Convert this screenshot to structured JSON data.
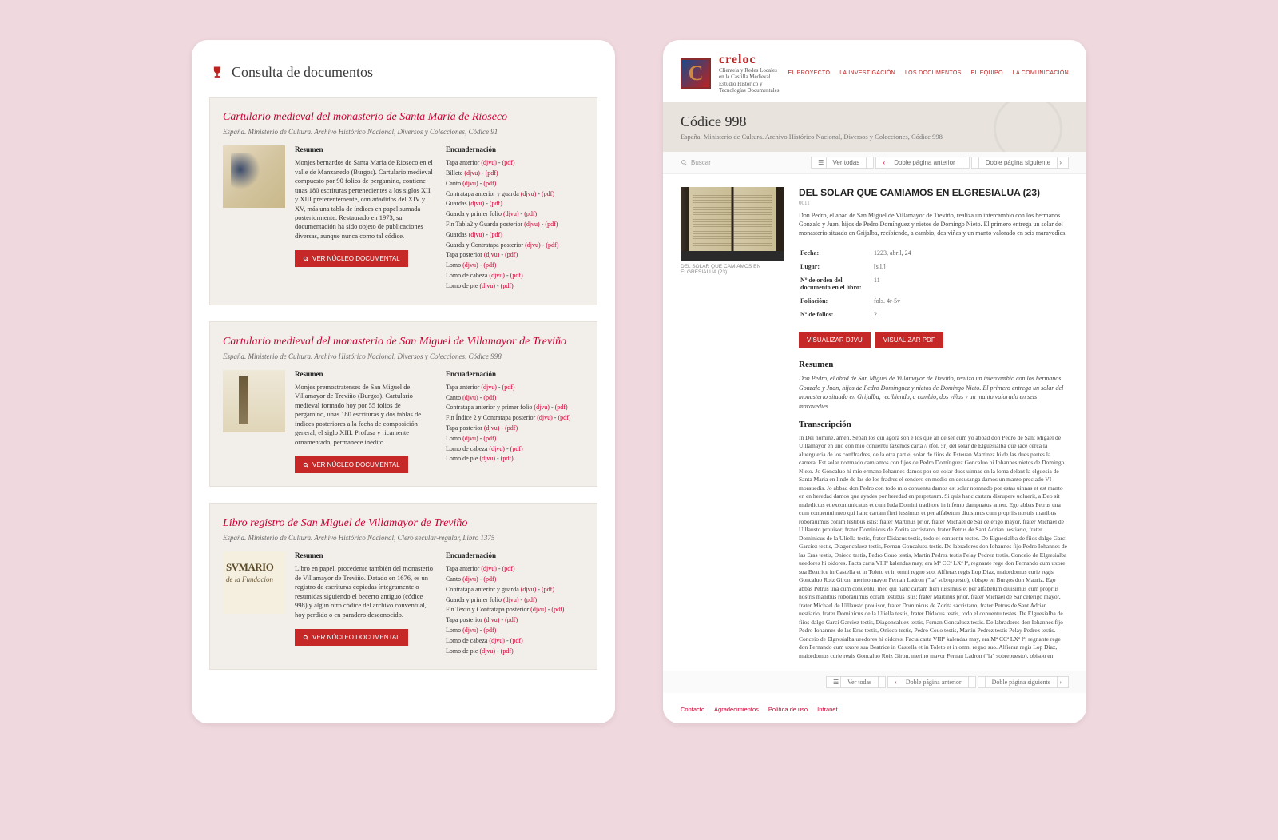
{
  "left": {
    "page_title": "Consulta de documentos",
    "cards": [
      {
        "title": "Cartulario medieval del monasterio de Santa María de Rioseco",
        "sub": "España. Ministerio de Cultura. Archivo Histórico Nacional, Diversos y Colecciones, Códice 91",
        "resumen_h": "Resumen",
        "resumen": "Monjes bernardos de Santa María de Rioseco en el valle de Manzanedo (Burgos). Cartulario medieval compuesto por 90 folios de pergamino, contiene unas 180 escrituras pertenecientes a los siglos XII y XIII preferentemente, con añadidos del XIV y XV, más una tabla de índices en papel sumada posteriormente. Restaurado en 1973, su documentación ha sido objeto de publicaciones diversas, aunque nunca como tal códice.",
        "btn": "VER NÚCLEO DOCUMENTAL",
        "enc_h": "Encuadernación",
        "enc": [
          "Tapa anterior (djvu) - (pdf)",
          "Billete (djvu) - (pdf)",
          "Canto (djvu) - (pdf)",
          "Contratapa anterior y guarda (djvu) - (pdf)",
          "Guardas (djvu) - (pdf)",
          "Guarda y primer folio (djvu) - (pdf)",
          "Fin Tabla2 y Guarda posterior (djvu) - (pdf)",
          "Guardas (djvu) - (pdf)",
          "Guarda y Contratapa posterior (djvu) - (pdf)",
          "Tapa posterior (djvu) - (pdf)",
          "Lomo (djvu) - (pdf)",
          "Lomo de cabeza (djvu) - (pdf)",
          "Lomo de pie (djvu) - (pdf)"
        ]
      },
      {
        "title": "Cartulario medieval del monasterio de San Miguel de Villamayor de Treviño",
        "sub": "España. Ministerio de Cultura. Archivo Histórico Nacional, Diversos y Colecciones, Códice 998",
        "resumen_h": "Resumen",
        "resumen": "Monjes premostratenses de San Miguel de Villamayor de Treviño (Burgos). Cartulario medieval formado hoy por 55 folios de pergamino, unas 180 escrituras y dos tablas de índices posteriores a la fecha de composición general, el siglo XIII. Profusa y ricamente ornamentado, permanece inédito.",
        "btn": "VER NÚCLEO DOCUMENTAL",
        "enc_h": "Encuadernación",
        "enc": [
          "Tapa anterior (djvu) - (pdf)",
          "Canto (djvu) - (pdf)",
          "Contratapa anterior y primer folio (djvu) - (pdf)",
          "Fin Índice 2 y Contratapa posterior (djvu) - (pdf)",
          "Tapa posterior (djvu) - (pdf)",
          "Lomo (djvu) - (pdf)",
          "Lomo de cabeza (djvu) - (pdf)",
          "Lomo de pie (djvu) - (pdf)"
        ]
      },
      {
        "title": "Libro registro de San Miguel de Villamayor de Treviño",
        "sub": "España. Ministerio de Cultura. Archivo Histórico Nacional, Clero secular-regular, Libro 1375",
        "resumen_h": "Resumen",
        "resumen": "Libro en papel, procedente también del monasterio de Villamayor de Treviño. Datado en 1676, es un registro de escrituras copiadas íntegramente o resumidas siguiendo el becerro antiguo (códice 998) y algún otro códice del archivo conventual, hoy perdido o en paradero desconocido.",
        "btn": "VER NÚCLEO DOCUMENTAL",
        "enc_h": "Encuadernación",
        "enc": [
          "Tapa anterior (djvu) - (pdf)",
          "Canto (djvu) - (pdf)",
          "Contratapa anterior y guarda (djvu) - (pdf)",
          "Guarda y primer folio (djvu) - (pdf)",
          "Fin Texto y Contratapa posterior (djvu) - (pdf)",
          "Tapa posterior (djvu) - (pdf)",
          "Lomo (djvu) - (pdf)",
          "Lomo de cabeza (djvu) - (pdf)",
          "Lomo de pie (djvu) - (pdf)"
        ]
      }
    ]
  },
  "right": {
    "brand": "creloc",
    "brand_sub1": "Clientela y Redes Locales en la Castilla Medieval",
    "brand_sub2": "Estudio Histórico y Tecnologías Documentales",
    "nav": [
      "EL PROYECTO",
      "LA INVESTIGACIÓN",
      "LOS DOCUMENTOS",
      "EL EQUIPO",
      "LA COMUNICACIÓN"
    ],
    "hero_title": "Códice 998",
    "hero_sub": "España. Ministerio de Cultura. Archivo Histórico Nacional, Diversos y Colecciones, Códice 998",
    "search_ph": "Buscar",
    "pager": {
      "all": "Ver todas",
      "prev": "Doble página anterior",
      "next": "Doble página siguiente"
    },
    "viewer_cap": "DEL SOLAR QUE CAMIAMOS EN ELGRESIALUA (23)",
    "doc_title": "DEL SOLAR QUE CAMIAMOS EN ELGRESIALUA (23)",
    "doc_id": "0011",
    "doc_intro": "Don Pedro, el abad de San Miguel de Villamayor de Treviño, realiza un intercambio con los hermanos Gonzalo y Juan, hijos de Pedro Domínguez y nietos de Domingo Nieto. El primero entrega un solar del monasterio situado en Grijalba, recibiendo, a cambio, dos viñas y un manto valorado en seis maravedíes.",
    "meta": [
      {
        "k": "Fecha:",
        "v": "1223, abril, 24"
      },
      {
        "k": "Lugar:",
        "v": "[s.l.]"
      },
      {
        "k": "Nº de orden del documento en el libro:",
        "v": "11"
      },
      {
        "k": "Foliación:",
        "v": "fols. 4r-5v"
      },
      {
        "k": "Nº de folios:",
        "v": "2"
      }
    ],
    "btn_djvu": "VISUALIZAR DJVU",
    "btn_pdf": "VISUALIZAR PDF",
    "resumen_h": "Resumen",
    "resumen": "Don Pedro, el abad de San Miguel de Villamayor de Treviño, realiza un intercambio con los hermanos Gonzalo y Juan, hijos de Pedro Domínguez y nietos de Domingo Nieto. El primero entrega un solar del monasterio situado en Grijalba, recibiendo, a cambio, dos viñas y un manto valorado en seis maravedíes.",
    "trans_h": "Transcripción",
    "trans": "In Dei nomine, amen. Sepan los qui agora son e los que an de ser cum yo abbad don Pedro de Sant Migael de Uillamayor en uno con mio conuentu fazemos carta // (fol. 5r) del solar de Elguesialba que iace cerca la aluergueria de los conffradres, de la otra part el solar de fiios de Esteuan Martinez hi de las dues partes la carrera. Est solar nomnado camiamos con fijos de Pedro Domínguez Goncaluo hi Iohannes nietos de Domingo Nieto. Jo Goncaluo hi mio ermano Iohannes damos por est solar dues uinnas en la loma delant la elguesia de Santa Maria en linde de las de los fradres el sendero en medio en desusanga damos un manto preciado VI morauedis. Jo abbad don Pedro con todo mio conuentu damos est solar nomnado por estas uinnas et est manto en en heredad damos que ayades por heredad en perpetuum. Si quis hanc cartam disrupere uoluerit, a Deo sit maledictus et excomunicatus et cum Iuda Domini traditore in inferno dampnatus amen. Ego abbas Petrus una cum conuentui meo qui hanc cartam fieri iussimus et per alfabetum diuisimus cum propriis nostris manibus roborauimus coram testibus istis: frater Martinus prior, frater Michael de Sar celerigo mayor, frater Michael de Uillausto prouisor, frater Dominicus de Zorita sacristano, frater Petrus de Sant Adrian uestiario, frater Dominicus de la Uliella testis, frater Didacus testis, todo el conuentu testes. De Elguesialba de fiios dalgo Garci Garciez testis, Diagoncaluez testis, Fernan Goncaluez testis. De labradores don Iohannes fijo Pedro Iohannes de las Eras testis, Onieco testis, Pedro Couo testis, Martin Pedrez testis Pelay Pedrez testis. Conceio de Elgresialba ueedores hi oidores. Facta carta VIIIº kalendas may, era Mª CCª LXª Iª, regnante rege don Fernando cum uxore sua Beatrice in Castella et in Toleto et in omni regno suo. Alfieraz regis Lop Diaz, maiordomus curie regis Goncaluo Roiz Giron, merino mayor Fernan Ladron (\"la\" sobrepuesto), obispo en Burgos don Mauriz. Ego abbas Petrus una cum conuentui meo qui hanc cartam fieri iussimus et per alfabetum diuisimus cum propriis nostris manibus roborauimus coram testibus istis: frater Martinus prior, frater Michael de Sar celerigo mayor, frater Michael de Uillausto prouisor, frater Dominicus de Zorita sacristano, frater Petrus de Sant Adrian uestiario, frater Dominicus de la Uliella testis, frater Didacus testis, todo el conuentu testes. De Elguesialba de fiios dalgo Garci Garciez testis, Diagoncaluez testis, Fernan Goncaluez testis. De labradores don Iohannes fijo Pedro Iohannes de las Eras testis, Onieco testis, Pedro Couo testis, Martin Pedrez testis Pelay Pedrez testis. Conceio de Elgresialba ueedores hi oidores. Facta carta VIIIº kalendas may, era Mª CCª LXª Iª, regnante rege don Fernando cum uxore sua Beatrice in Castella et in Toleto et in omni regno suo. Alfieraz regis Lop Diaz, maiordomus curie regis Goncaluo Roiz Giron, merino mayor Fernan Ladron (\"la\" sobrepuesto), obispo en Burgos don Mauriz.",
    "footer": [
      "Contacto",
      "Agradecimientos",
      "Política de uso",
      "Intranet"
    ]
  }
}
